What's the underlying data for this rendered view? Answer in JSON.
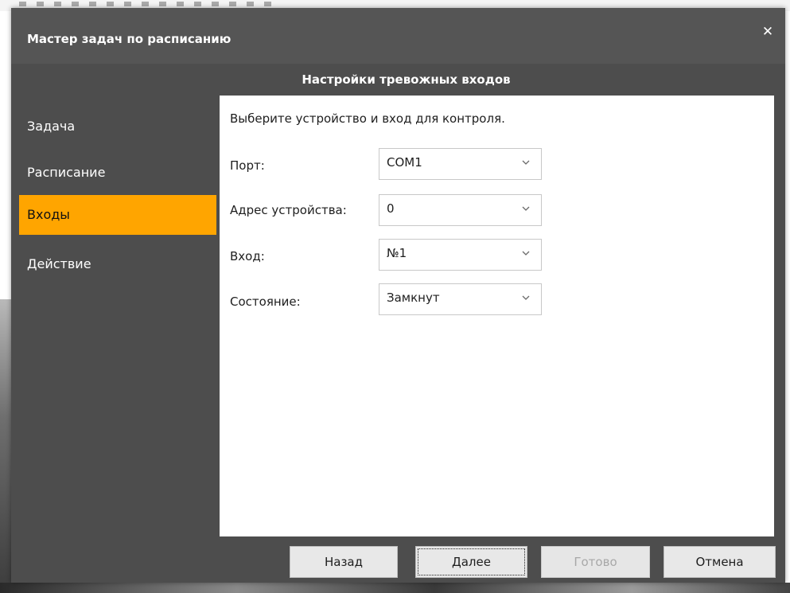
{
  "window": {
    "title": "Мастер задач по расписанию",
    "close_glyph": "✕"
  },
  "section_title": "Настройки тревожных входов",
  "sidebar": {
    "items": [
      {
        "label": "Задача",
        "active": false
      },
      {
        "label": "Расписание",
        "active": false
      },
      {
        "label": "Входы",
        "active": true
      },
      {
        "label": "Действие",
        "active": false
      }
    ]
  },
  "content": {
    "prompt": "Выберите устройство и вход для контроля.",
    "fields": [
      {
        "label": "Порт:",
        "value": "COM1"
      },
      {
        "label": "Адрес устройства:",
        "value": "0"
      },
      {
        "label": "Вход:",
        "value": "№1"
      },
      {
        "label": "Состояние:",
        "value": "Замкнут"
      }
    ]
  },
  "buttons": {
    "back": "Назад",
    "next": "Далее",
    "finish": "Готово",
    "cancel": "Отмена"
  },
  "colors": {
    "accent": "#ffa500",
    "dialog_bg": "#4d4d4d",
    "titlebar_bg": "#555555",
    "content_bg": "#ffffff"
  },
  "icons": {
    "close": "close-icon",
    "dropdown": "chevron-down-icon"
  }
}
